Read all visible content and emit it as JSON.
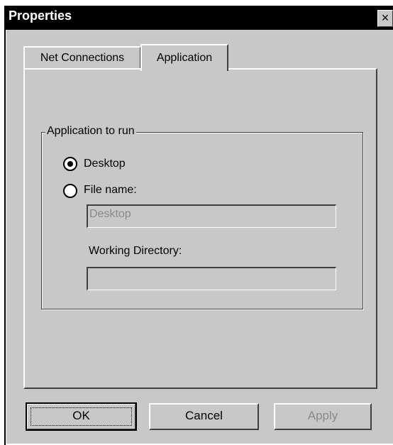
{
  "window": {
    "title": "Properties",
    "close_glyph": "×"
  },
  "tabs": [
    {
      "label": "Net Connections",
      "selected": false
    },
    {
      "label": "Application",
      "selected": true
    }
  ],
  "group": {
    "legend": "Application to run",
    "options": [
      {
        "label": "Desktop",
        "checked": true
      },
      {
        "label": "File name:",
        "checked": false
      }
    ],
    "file_name_value": "Desktop",
    "working_directory_label": "Working Directory:",
    "working_directory_value": ""
  },
  "buttons": {
    "ok": "OK",
    "cancel": "Cancel",
    "apply": "Apply"
  },
  "colors": {
    "face": "#c8c8c8",
    "titlebar": "#000000",
    "disabled_text": "#8a8a8a"
  }
}
